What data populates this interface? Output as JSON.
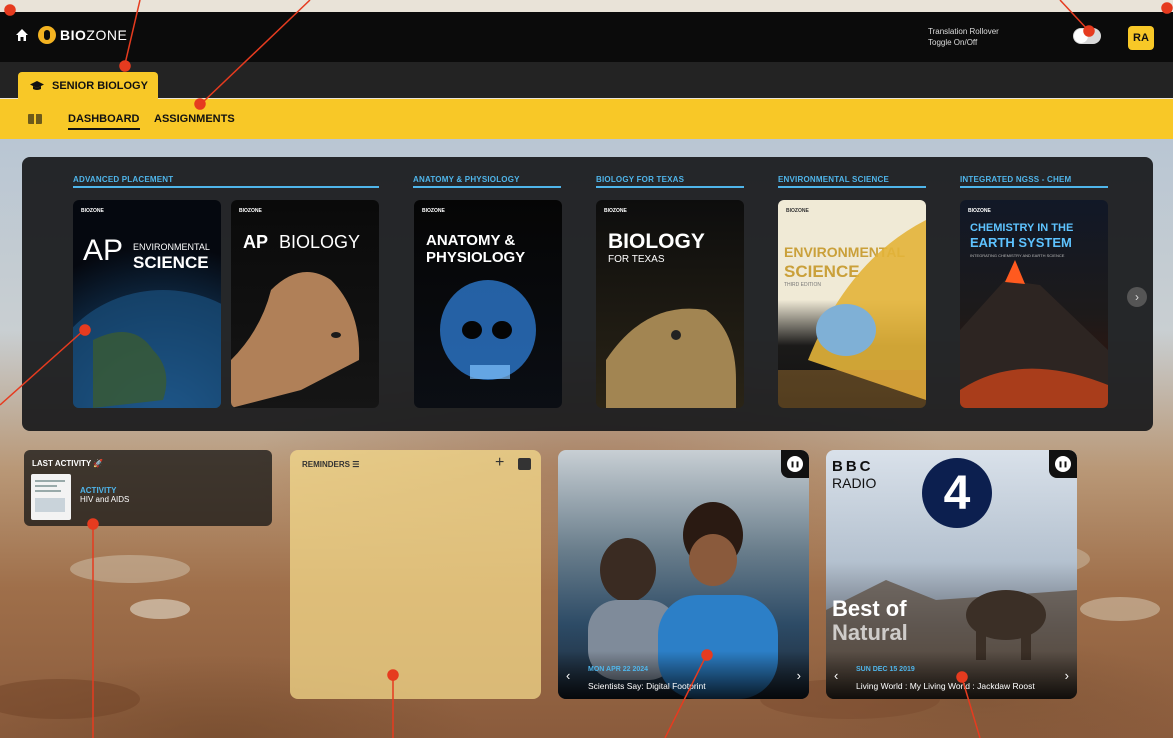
{
  "topbar": {
    "logo_bold": "BIO",
    "logo_thin": "ZONE",
    "translation_line1": "Translation Rollover",
    "translation_line2": "Toggle On/Off",
    "avatar_initials": "RA"
  },
  "course_tab": {
    "label": "SENIOR BIOLOGY"
  },
  "nav": {
    "dashboard": "DASHBOARD",
    "assignments": "ASSIGNMENTS"
  },
  "shelf": {
    "categories": [
      "ADVANCED PLACEMENT",
      "ANATOMY & PHYSIOLOGY",
      "BIOLOGY FOR TEXAS",
      "ENVIRONMENTAL SCIENCE",
      "INTEGRATED NGSS - CHEM"
    ],
    "books": [
      {
        "brand": "BIOZONE",
        "line1": "AP",
        "line2": "ENVIRONMENTAL",
        "line3": "SCIENCE"
      },
      {
        "brand": "BIOZONE",
        "line1": "AP",
        "line2": "BIOLOGY"
      },
      {
        "brand": "BIOZONE",
        "line1": "ANATOMY &",
        "line2": "PHYSIOLOGY"
      },
      {
        "brand": "BIOZONE",
        "line1": "BIOLOGY",
        "line2": "FOR TEXAS"
      },
      {
        "brand": "BIOZONE",
        "line1": "ENVIRONMENTAL",
        "line2": "SCIENCE",
        "line3": "THIRD EDITION"
      },
      {
        "brand": "BIOZONE",
        "line1": "CHEMISTRY IN THE",
        "line2": "EARTH SYSTEM",
        "line3": "INTEGRATING CHEMISTRY AND EARTH SCIENCE"
      }
    ],
    "next_glyph": "›"
  },
  "last_activity": {
    "title": "LAST ACTIVITY",
    "type": "ACTIVITY",
    "name": "HIV and AIDS"
  },
  "reminders": {
    "title": "REMINDERS",
    "plus": "+"
  },
  "media1": {
    "date": "MON APR 22 2024",
    "title": "Scientists Say: Digital Footprint",
    "prev": "‹",
    "next": "›"
  },
  "media2": {
    "brand_top": "BBC",
    "brand_bottom": "RADIO",
    "station": "4",
    "overlay_line1": "Best of",
    "overlay_line2": "Natural",
    "date": "SUN DEC 15 2019",
    "title": "Living World : My Living World : Jackdaw Roost",
    "prev": "‹",
    "next": "›"
  },
  "colors": {
    "accent": "#f8c827",
    "link_blue": "#4fb5ea",
    "topbar": "#0b0b0b"
  }
}
